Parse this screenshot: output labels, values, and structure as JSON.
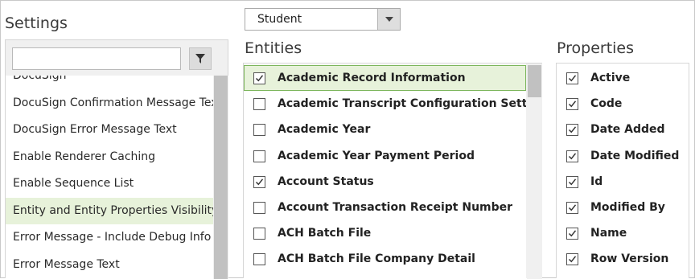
{
  "settings": {
    "title": "Settings",
    "search": {
      "value": "",
      "placeholder": ""
    },
    "filter_icon": "filter-icon",
    "items": [
      {
        "label": "DocuSign",
        "selected": false
      },
      {
        "label": "DocuSign Confirmation Message Text",
        "selected": false
      },
      {
        "label": "DocuSign Error Message Text",
        "selected": false
      },
      {
        "label": "Enable Renderer Caching",
        "selected": false
      },
      {
        "label": "Enable Sequence List",
        "selected": false
      },
      {
        "label": "Entity and Entity Properties Visibility",
        "selected": true
      },
      {
        "label": "Error Message - Include Debug Info",
        "selected": false
      },
      {
        "label": "Error Message Text",
        "selected": false
      }
    ]
  },
  "entity_select": {
    "value": "Student",
    "icon": "chevron-down-icon"
  },
  "entities": {
    "title": "Entities",
    "items": [
      {
        "label": "Academic Record Information",
        "checked": true,
        "selected": true
      },
      {
        "label": "Academic Transcript Configuration Setting",
        "checked": false,
        "selected": false
      },
      {
        "label": "Academic Year",
        "checked": false,
        "selected": false
      },
      {
        "label": "Academic Year Payment Period",
        "checked": false,
        "selected": false
      },
      {
        "label": "Account Status",
        "checked": true,
        "selected": false
      },
      {
        "label": "Account Transaction Receipt Number",
        "checked": false,
        "selected": false
      },
      {
        "label": "ACH Batch File",
        "checked": false,
        "selected": false
      },
      {
        "label": "ACH Batch File Company Detail",
        "checked": false,
        "selected": false
      }
    ]
  },
  "properties": {
    "title": "Properties",
    "items": [
      {
        "label": "Active",
        "checked": true
      },
      {
        "label": "Code",
        "checked": true
      },
      {
        "label": "Date Added",
        "checked": true
      },
      {
        "label": "Date Modified",
        "checked": true
      },
      {
        "label": "Id",
        "checked": true
      },
      {
        "label": "Modified By",
        "checked": true
      },
      {
        "label": "Name",
        "checked": true
      },
      {
        "label": "Row Version",
        "checked": true
      }
    ]
  },
  "colors": {
    "selected_bg": "#e7f2da",
    "selected_border": "#7cb65c",
    "panel_bg": "#f0f0f0"
  }
}
